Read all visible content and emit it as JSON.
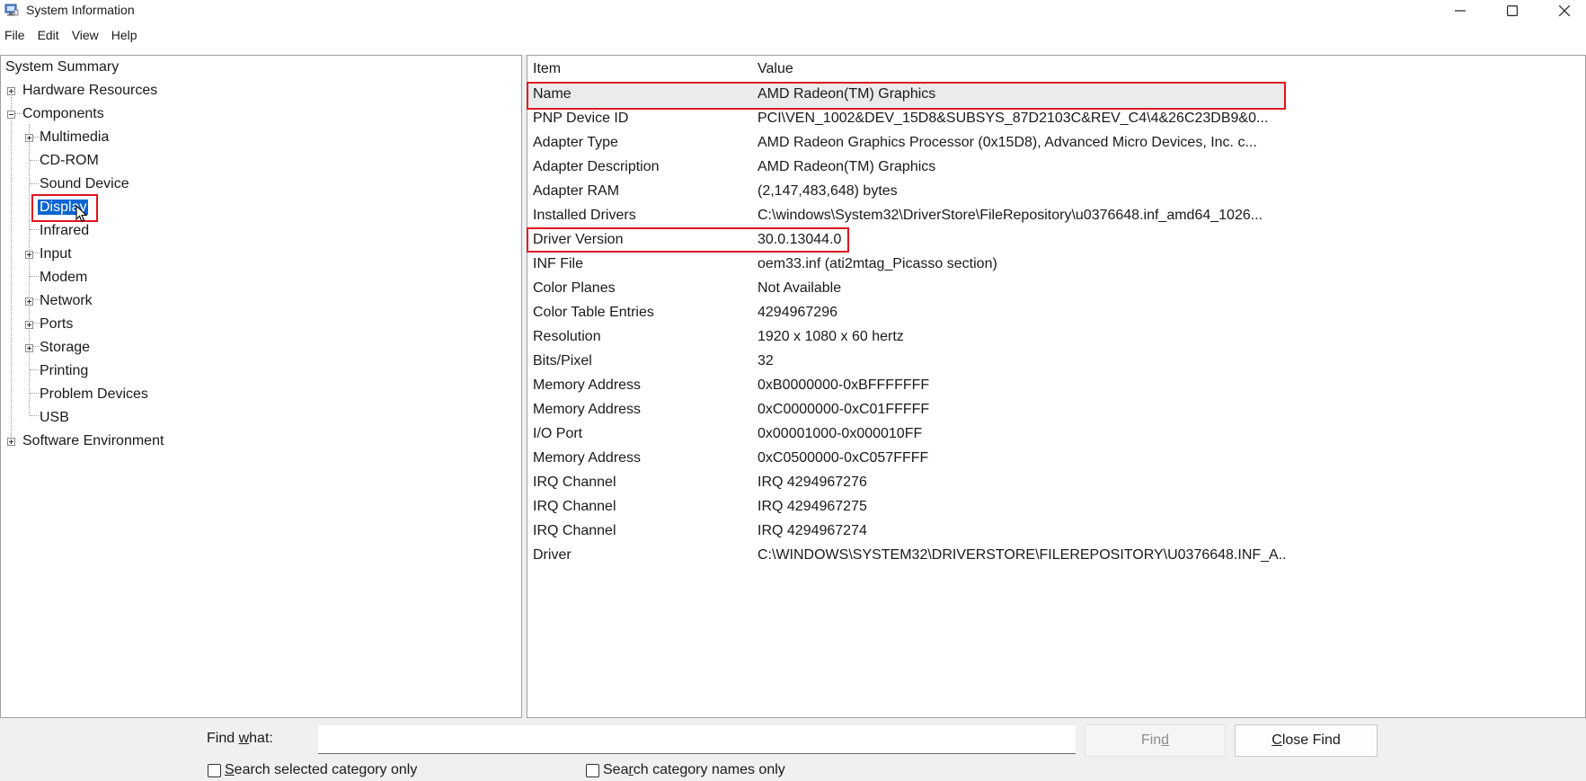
{
  "window": {
    "title": "System Information",
    "icon": "system-information-icon",
    "controls": [
      "minimize-icon",
      "maximize-icon",
      "close-icon"
    ]
  },
  "menu": [
    "File",
    "Edit",
    "View",
    "Help"
  ],
  "tree": {
    "root": "System Summary",
    "hardware": "Hardware Resources",
    "components": "Components",
    "children": {
      "multimedia": "Multimedia",
      "cdrom": "CD-ROM",
      "sound": "Sound Device",
      "display": "Display",
      "infrared": "Infrared",
      "input": "Input",
      "modem": "Modem",
      "network": "Network",
      "ports": "Ports",
      "storage": "Storage",
      "printing": "Printing",
      "problem": "Problem Devices",
      "usb": "USB"
    },
    "software": "Software Environment",
    "selected": "Display"
  },
  "list": {
    "headers": {
      "item": "Item",
      "value": "Value"
    },
    "rows": [
      {
        "item": "Name",
        "value": "AMD Radeon(TM) Graphics"
      },
      {
        "item": "PNP Device ID",
        "value": "PCI\\VEN_1002&DEV_15D8&SUBSYS_87D2103C&REV_C4\\4&26C23DB9&0..."
      },
      {
        "item": "Adapter Type",
        "value": "AMD Radeon Graphics Processor (0x15D8), Advanced Micro Devices, Inc. c..."
      },
      {
        "item": "Adapter Description",
        "value": "AMD Radeon(TM) Graphics"
      },
      {
        "item": "Adapter RAM",
        "value": "(2,147,483,648) bytes"
      },
      {
        "item": "Installed Drivers",
        "value": "C:\\windows\\System32\\DriverStore\\FileRepository\\u0376648.inf_amd64_1026..."
      },
      {
        "item": "Driver Version",
        "value": "30.0.13044.0"
      },
      {
        "item": "INF File",
        "value": "oem33.inf (ati2mtag_Picasso section)"
      },
      {
        "item": "Color Planes",
        "value": "Not Available"
      },
      {
        "item": "Color Table Entries",
        "value": "4294967296"
      },
      {
        "item": "Resolution",
        "value": "1920 x 1080 x 60 hertz"
      },
      {
        "item": "Bits/Pixel",
        "value": "32"
      },
      {
        "item": "Memory Address",
        "value": "0xB0000000-0xBFFFFFFF"
      },
      {
        "item": "Memory Address",
        "value": "0xC0000000-0xC01FFFFF"
      },
      {
        "item": "I/O Port",
        "value": "0x00001000-0x000010FF"
      },
      {
        "item": "Memory Address",
        "value": "0xC0500000-0xC057FFFF"
      },
      {
        "item": "IRQ Channel",
        "value": "IRQ 4294967276"
      },
      {
        "item": "IRQ Channel",
        "value": "IRQ 4294967275"
      },
      {
        "item": "IRQ Channel",
        "value": "IRQ 4294967274"
      },
      {
        "item": "Driver",
        "value": "C:\\WINDOWS\\SYSTEM32\\DRIVERSTORE\\FILEREPOSITORY\\U0376648.INF_A..."
      }
    ]
  },
  "find": {
    "label_prefix": "Find ",
    "label_key": "w",
    "label_suffix": "hat:",
    "query": "",
    "find_button": {
      "pre": "Fin",
      "key": "d",
      "post": ""
    },
    "close_button": {
      "pre": "",
      "key": "C",
      "post": "lose Find"
    },
    "check_selected": {
      "pre": "",
      "key": "S",
      "post": "earch selected category only",
      "checked": false
    },
    "check_names": {
      "pre": "Sea",
      "key": "r",
      "post": "ch category names only",
      "checked": false
    }
  },
  "colors": {
    "selection": "#0a64d2",
    "annotation": "#e0141e",
    "row_highlight": "#ebebeb"
  }
}
